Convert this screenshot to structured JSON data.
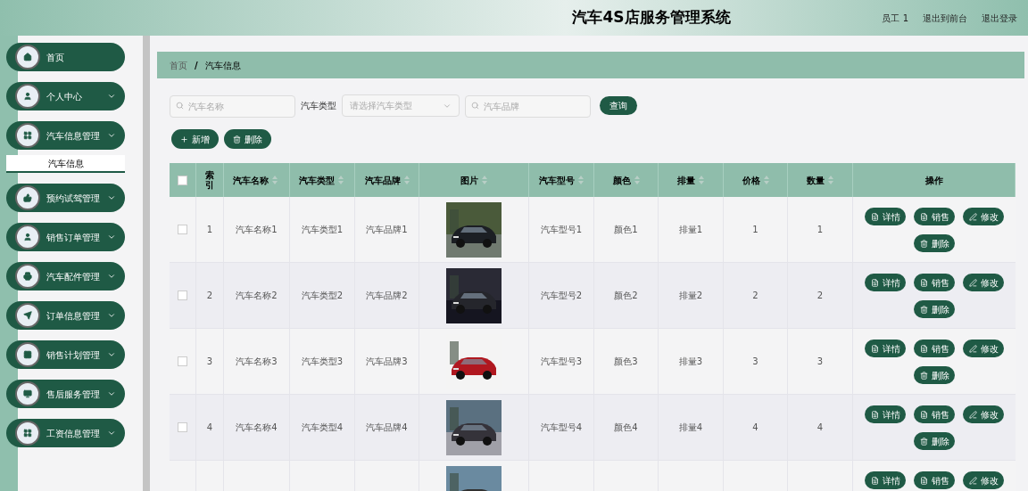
{
  "header": {
    "title": "汽车4S店服务管理系统",
    "links": [
      "员工 1",
      "退出到前台",
      "退出登录"
    ]
  },
  "sidebar": {
    "items": [
      {
        "label": "首页",
        "kind": "link"
      },
      {
        "label": "个人中心",
        "kind": "menu"
      },
      {
        "label": "汽车信息管理",
        "kind": "menu",
        "children": [
          {
            "label": "汽车信息",
            "selected": true
          }
        ]
      },
      {
        "label": "预约试驾管理",
        "kind": "menu"
      },
      {
        "label": "销售订单管理",
        "kind": "menu"
      },
      {
        "label": "汽车配件管理",
        "kind": "menu"
      },
      {
        "label": "订单信息管理",
        "kind": "menu"
      },
      {
        "label": "销售计划管理",
        "kind": "menu"
      },
      {
        "label": "售后服务管理",
        "kind": "menu"
      },
      {
        "label": "工资信息管理",
        "kind": "menu"
      }
    ]
  },
  "breadcrumb": {
    "items": [
      "首页",
      "汽车信息"
    ],
    "separator": "/"
  },
  "search": {
    "name_placeholder": "汽车名称",
    "type_label": "汽车类型",
    "type_placeholder": "请选择汽车类型",
    "brand_placeholder": "汽车品牌",
    "query_button": "查询"
  },
  "toolbar": {
    "add_button": "新增",
    "delete_button": "删除"
  },
  "table": {
    "all_checked": false,
    "columns": [
      {
        "label": "索引",
        "sortable": false
      },
      {
        "label": "汽车名称",
        "sortable": true
      },
      {
        "label": "汽车类型",
        "sortable": true
      },
      {
        "label": "汽车品牌",
        "sortable": true
      },
      {
        "label": "图片",
        "sortable": true
      },
      {
        "label": "汽车型号",
        "sortable": true
      },
      {
        "label": "颜色",
        "sortable": true
      },
      {
        "label": "排量",
        "sortable": true
      },
      {
        "label": "价格",
        "sortable": true
      },
      {
        "label": "数量",
        "sortable": true
      },
      {
        "label": "操作",
        "sortable": false
      }
    ],
    "rows": [
      {
        "checked": false,
        "cells": [
          "1",
          "汽车名称1",
          "汽车类型1",
          "汽车品牌1",
          {
            "kind": "picture"
          },
          "汽车型号1",
          "颜色1",
          "排量1",
          "1",
          "1"
        ],
        "actions": [
          "详情",
          "销售",
          "修改",
          "删除"
        ]
      },
      {
        "checked": false,
        "cells": [
          "2",
          "汽车名称2",
          "汽车类型2",
          "汽车品牌2",
          {
            "kind": "picture"
          },
          "汽车型号2",
          "颜色2",
          "排量2",
          "2",
          "2"
        ],
        "actions": [
          "详情",
          "销售",
          "修改",
          "删除"
        ]
      },
      {
        "checked": false,
        "cells": [
          "3",
          "汽车名称3",
          "汽车类型3",
          "汽车品牌3",
          {
            "kind": "picture"
          },
          "汽车型号3",
          "颜色3",
          "排量3",
          "3",
          "3"
        ],
        "actions": [
          "详情",
          "销售",
          "修改",
          "删除"
        ]
      },
      {
        "checked": false,
        "cells": [
          "4",
          "汽车名称4",
          "汽车类型4",
          "汽车品牌4",
          {
            "kind": "picture"
          },
          "汽车型号4",
          "颜色4",
          "排量4",
          "4",
          "4"
        ],
        "actions": [
          "详情",
          "销售",
          "修改",
          "删除"
        ]
      },
      {
        "cells": [
          null,
          null,
          null,
          null,
          {
            "kind": "picture"
          }
        ],
        "actions": [
          "详情",
          "销售",
          "修改"
        ]
      }
    ]
  }
}
